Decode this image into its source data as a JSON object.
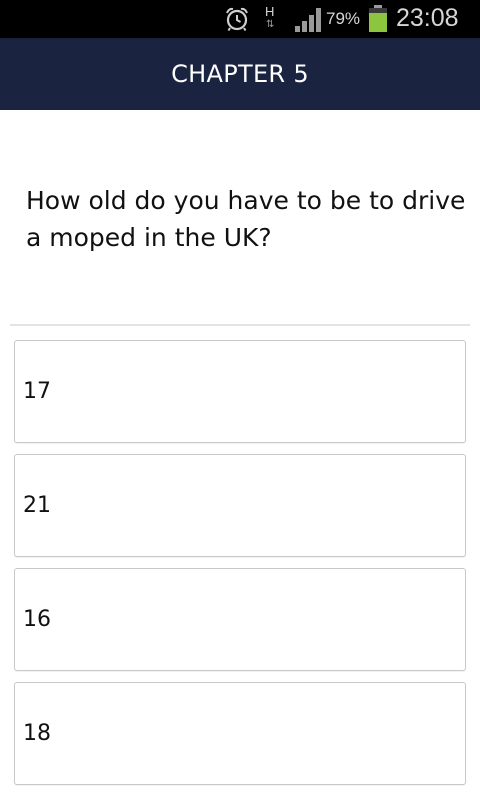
{
  "status_bar": {
    "battery_percent": "79%",
    "time": "23:08",
    "network_type": "H",
    "network_activity": "⇅",
    "icons": [
      "alarm-icon",
      "network-activity-icon",
      "signal-strength-icon",
      "battery-icon"
    ],
    "battery_level": 0.79,
    "battery_color": "#8cc63f"
  },
  "header": {
    "title": "CHAPTER 5",
    "background": "#1a2340"
  },
  "quiz": {
    "question": "How old do you have to be to drive a moped in the UK?",
    "answers": [
      {
        "label": "17"
      },
      {
        "label": "21"
      },
      {
        "label": "16"
      },
      {
        "label": "18"
      }
    ]
  }
}
